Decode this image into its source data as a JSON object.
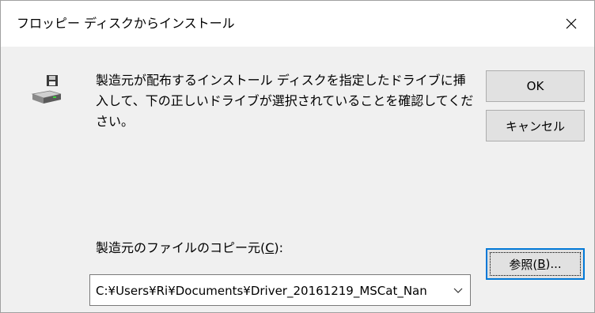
{
  "window": {
    "title": "フロッピー ディスクからインストール",
    "close_icon": "close-icon"
  },
  "dialog": {
    "icon": "floppy-drive-icon",
    "message": "製造元が配布するインストール ディスクを指定したドライブに挿入して、下の正しいドライブが選択されていることを確認してください。",
    "ok_label": "OK",
    "cancel_label": "キャンセル",
    "copy_from_label_prefix": "製造元のファイルのコピー元(",
    "copy_from_label_key": "C",
    "copy_from_label_suffix": "):",
    "path_value": "C:¥Users¥Ri¥Documents¥Driver_20161219_MSCat_Nan",
    "browse_label_prefix": "参照(",
    "browse_label_key": "B",
    "browse_label_suffix": ")..."
  },
  "colors": {
    "title_bg": "#ffffff",
    "client_bg": "#f0f0f0",
    "button_bg": "#e1e1e1",
    "focus_border": "#0078d7"
  }
}
